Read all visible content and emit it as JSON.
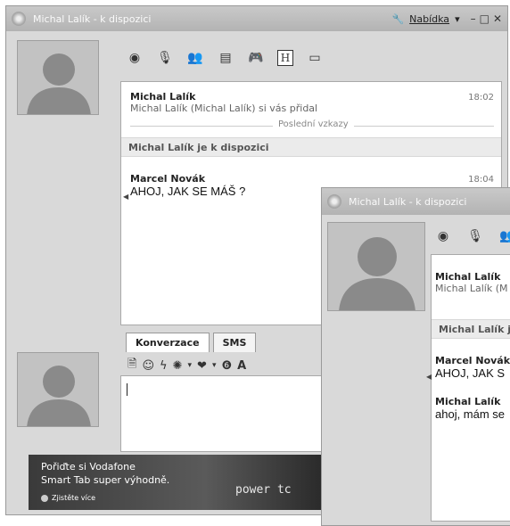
{
  "main_window": {
    "title": "Michal Lalík - k dispozici",
    "menu_label": "Nabídka",
    "toolbar_icons": [
      "webcam-icon",
      "microphone-icon",
      "contacts-icon",
      "files-icon",
      "games-icon",
      "history-icon",
      "card-icon"
    ],
    "history_letter": "H",
    "messages": [
      {
        "name": "Michal Lalík",
        "text": "Michal Lalík (Michal Lalík) si vás přidal",
        "time": "18:02"
      }
    ],
    "divider_label": "Poslední vzkazy",
    "status_line": "Michal Lalík je k dispozici",
    "chat_message": {
      "name": "Marcel Novák",
      "text": "AHOJ, JAK SE MÁŠ ?",
      "time": "18:04"
    },
    "tabs": [
      "Konverzace",
      "SMS"
    ],
    "banner": {
      "line1": "Pořiďte si Vodafone",
      "line2": "Smart Tab super výhodně.",
      "more": "Zjistěte více",
      "power": "power tc"
    }
  },
  "second_window": {
    "title": "Michal Lalík - k dispozici",
    "msg1_name": "Michal Lalík",
    "msg1_text": "Michal Lalík (M",
    "status_line": "Michal Lalík j",
    "msg2_name": "Marcel Novák",
    "msg2_text": "AHOJ, JAK S",
    "msg3_name": "Michal Lalík",
    "msg3_text": "ahoj, mám se"
  }
}
